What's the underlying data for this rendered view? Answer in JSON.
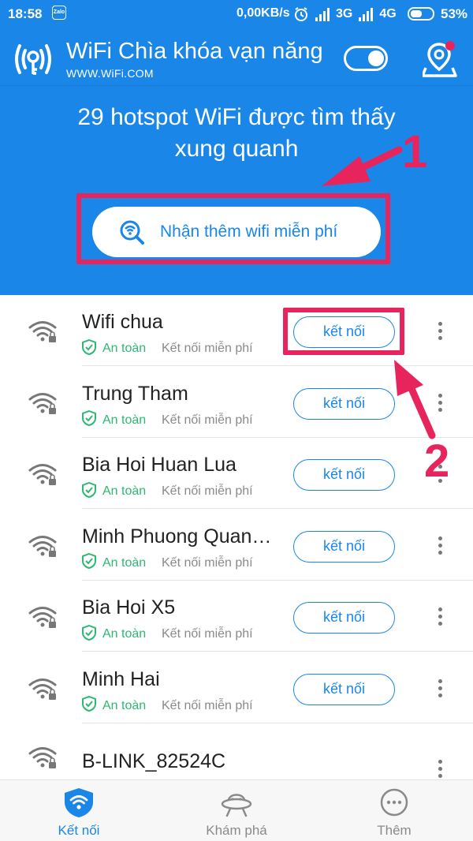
{
  "status_bar": {
    "time": "18:58",
    "notification_app": "Zalo",
    "net_speed": "0,00KB/s",
    "network_1": "3G",
    "network_2": "4G",
    "battery_percent": "53%",
    "battery_level": 0.53
  },
  "header": {
    "title": "WiFi Chìa khóa vạn năng",
    "subtitle": "WWW.WiFi.COM",
    "toggle_on": true
  },
  "hero": {
    "hotspot_line1": "29 hotspot WiFi được tìm thấy",
    "hotspot_line2": "xung quanh",
    "get_more_label": "Nhận thêm wifi miễn phí"
  },
  "annotations": {
    "step1": "1",
    "step2": "2",
    "highlight_color": "#e8245c"
  },
  "networks": [
    {
      "ssid": "Wifi chua",
      "safe": "An toàn",
      "type": "Kết nối miễn phí",
      "connect": "kết nối"
    },
    {
      "ssid": "Trung Tham",
      "safe": "An toàn",
      "type": "Kết nối miễn phí",
      "connect": "kết nối"
    },
    {
      "ssid": "Bia Hoi Huan Lua",
      "safe": "An toàn",
      "type": "Kết nối miễn phí",
      "connect": "kết nối"
    },
    {
      "ssid": "Minh Phuong Quan…",
      "safe": "An toàn",
      "type": "Kết nối miễn phí",
      "connect": "kết nối"
    },
    {
      "ssid": "Bia Hoi X5",
      "safe": "An toàn",
      "type": "Kết nối miễn phí",
      "connect": "kết nối"
    },
    {
      "ssid": "Minh Hai",
      "safe": "An toàn",
      "type": "Kết nối miễn phí",
      "connect": "kết nối"
    },
    {
      "ssid": "B-LINK_82524C"
    }
  ],
  "tabs": [
    {
      "label": "Kết nối",
      "icon": "wifi-shield-icon",
      "active": true
    },
    {
      "label": "Khám phá",
      "icon": "ufo-icon",
      "active": false
    },
    {
      "label": "Thêm",
      "icon": "more-circle-icon",
      "active": false
    }
  ],
  "colors": {
    "primary": "#1a86e8",
    "safe_green": "#2eb872",
    "annotation": "#e8245c"
  }
}
